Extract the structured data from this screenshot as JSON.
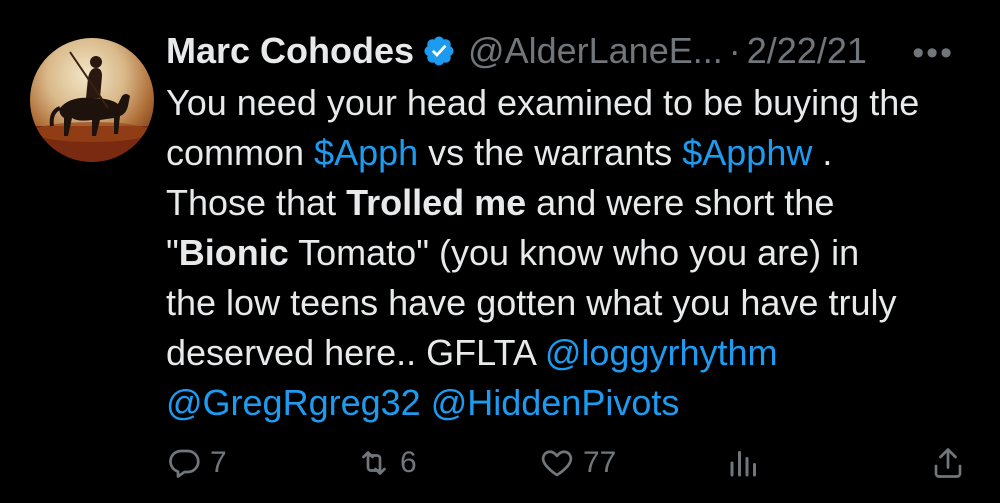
{
  "tweet": {
    "author_name": "Marc Cohodes",
    "handle": "@AlderLaneE...",
    "separator": "·",
    "date": "2/22/21",
    "more_label": "•••",
    "lines": [
      [
        {
          "t": "You need your head examined to be buying the",
          "s": "text"
        }
      ],
      [
        {
          "t": "common ",
          "s": "text"
        },
        {
          "t": "$Apph",
          "s": "link"
        },
        {
          "t": " vs the warrants ",
          "s": "text"
        },
        {
          "t": "$Apphw",
          "s": "link"
        },
        {
          "t": " .",
          "s": "text"
        }
      ],
      [
        {
          "t": "Those that ",
          "s": "text"
        },
        {
          "t": "Trolled me",
          "s": "bold"
        },
        {
          "t": " and were short the",
          "s": "text"
        }
      ],
      [
        {
          "t": "\"",
          "s": "text"
        },
        {
          "t": "Bionic",
          "s": "bold"
        },
        {
          "t": " Tomato\" (you know who you are) in",
          "s": "text"
        }
      ],
      [
        {
          "t": "the low teens have gotten what you have truly",
          "s": "text"
        }
      ],
      [
        {
          "t": "deserved here.. GFLTA  ",
          "s": "text"
        },
        {
          "t": "@loggyrhythm",
          "s": "link"
        }
      ],
      [
        {
          "t": "@GregRgreg32",
          "s": "link"
        },
        {
          "t": " ",
          "s": "text"
        },
        {
          "t": "@HiddenPivots",
          "s": "link"
        }
      ]
    ]
  },
  "actions": {
    "replies": "7",
    "retweets": "6",
    "likes": "77"
  },
  "icons": {
    "avatar": "horseman-avatar",
    "verified": "verified-badge-icon",
    "reply": "reply-icon",
    "retweet": "retweet-icon",
    "like": "heart-icon",
    "views": "views-icon",
    "share": "share-icon"
  },
  "colors": {
    "background": "#000000",
    "text": "#e7e9ea",
    "secondary": "#71767b",
    "link": "#1d9bf0"
  }
}
